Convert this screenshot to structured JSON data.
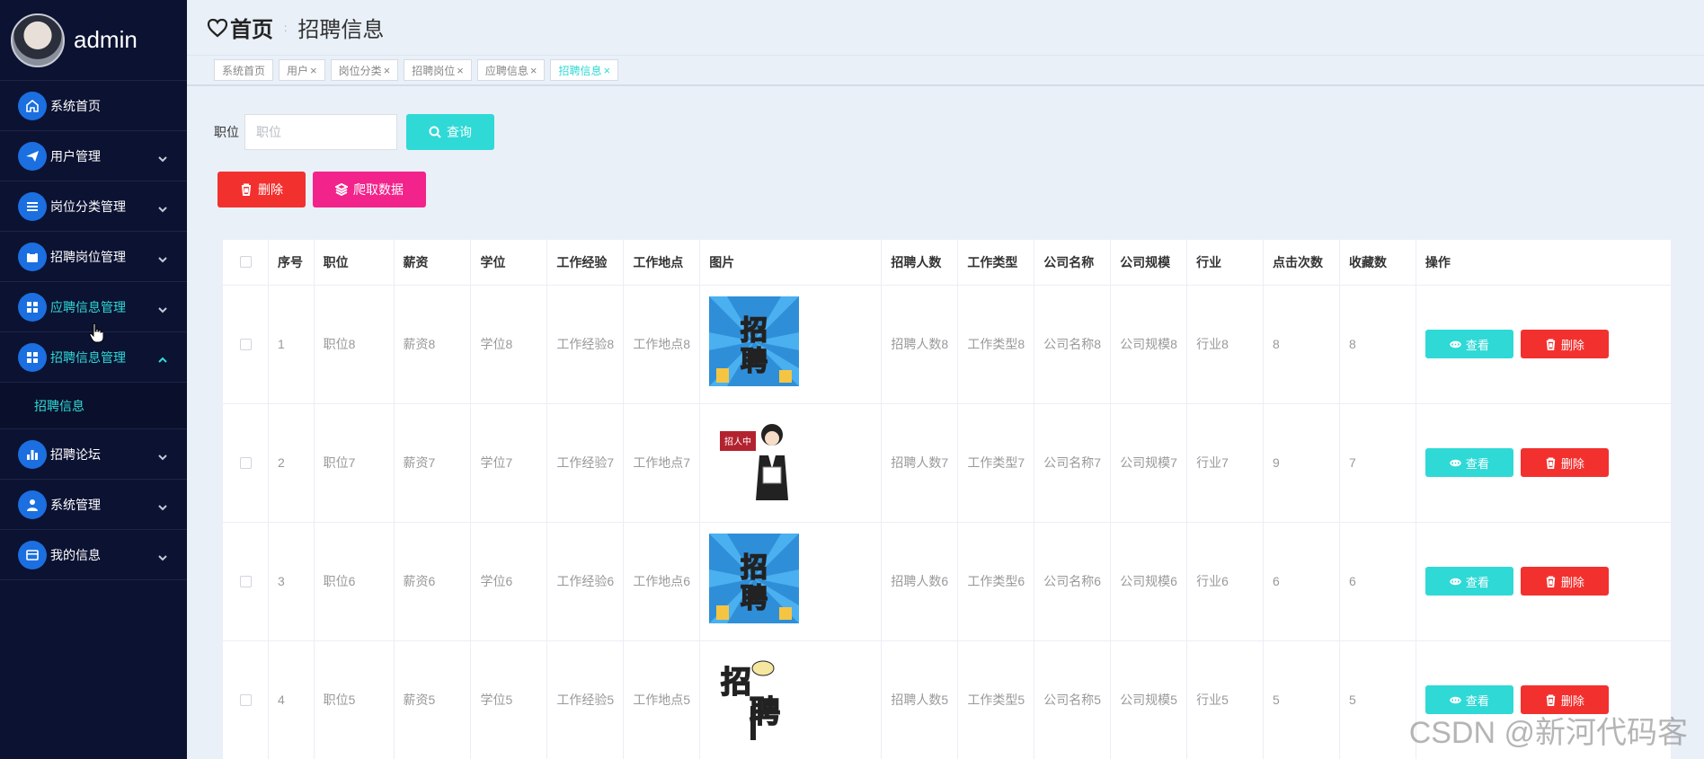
{
  "sidebar": {
    "username": "admin",
    "items": [
      {
        "label": "系统首页"
      },
      {
        "label": "用户管理"
      },
      {
        "label": "岗位分类管理"
      },
      {
        "label": "招聘岗位管理"
      },
      {
        "label": "应聘信息管理"
      },
      {
        "label": "招聘信息管理"
      },
      {
        "label": "招聘论坛"
      },
      {
        "label": "系统管理"
      },
      {
        "label": "我的信息"
      }
    ],
    "submenu": {
      "label": "招聘信息"
    }
  },
  "header": {
    "home": "首页",
    "separator": ":",
    "current": "招聘信息"
  },
  "tags": [
    {
      "label": "系统首页"
    },
    {
      "label": "用户"
    },
    {
      "label": "岗位分类"
    },
    {
      "label": "招聘岗位"
    },
    {
      "label": "应聘信息"
    },
    {
      "label": "招聘信息"
    }
  ],
  "tag_close": "×",
  "search": {
    "label": "职位",
    "placeholder": "职位",
    "button": "查询"
  },
  "toolbar": {
    "delete": "删除",
    "crawl": "爬取数据"
  },
  "table": {
    "headers": [
      "序号",
      "职位",
      "薪资",
      "学位",
      "工作经验",
      "工作地点",
      "图片",
      "招聘人数",
      "工作类型",
      "公司名称",
      "公司规模",
      "行业",
      "点击次数",
      "收藏数",
      "操作"
    ],
    "view_label": "查看",
    "delete_label": "删除",
    "rows": [
      {
        "idx": "1",
        "job": "职位8",
        "salary": "薪资8",
        "degree": "学位8",
        "exp": "工作经验8",
        "place": "工作地点8",
        "image": "recruit-poster",
        "count": "招聘人数8",
        "type": "工作类型8",
        "company": "公司名称8",
        "scale": "公司规模8",
        "industry": "行业8",
        "clicks": "8",
        "favs": "8"
      },
      {
        "idx": "2",
        "job": "职位7",
        "salary": "薪资7",
        "degree": "学位7",
        "exp": "工作经验7",
        "place": "工作地点7",
        "image": "recruiter-girl",
        "count": "招聘人数7",
        "type": "工作类型7",
        "company": "公司名称7",
        "scale": "公司规模7",
        "industry": "行业7",
        "clicks": "9",
        "favs": "7"
      },
      {
        "idx": "3",
        "job": "职位6",
        "salary": "薪资6",
        "degree": "学位6",
        "exp": "工作经验6",
        "place": "工作地点6",
        "image": "recruit-poster",
        "count": "招聘人数6",
        "type": "工作类型6",
        "company": "公司名称6",
        "scale": "公司规模6",
        "industry": "行业6",
        "clicks": "6",
        "favs": "6"
      },
      {
        "idx": "4",
        "job": "职位5",
        "salary": "薪资5",
        "degree": "学位5",
        "exp": "工作经验5",
        "place": "工作地点5",
        "image": "recruit-sign",
        "count": "招聘人数5",
        "type": "工作类型5",
        "company": "公司名称5",
        "scale": "公司规模5",
        "industry": "行业5",
        "clicks": "5",
        "favs": "5"
      }
    ]
  },
  "images": {
    "poster_text": "招聘",
    "girl_sign": "招人中",
    "sign_text": "招聘"
  },
  "watermark": "CSDN @新河代码客",
  "colors": {
    "sidebar_bg": "#0c1232",
    "accent_teal": "#2fd9d6",
    "danger_red": "#f2312f",
    "pink": "#f2238b",
    "icon_blue": "#1b6fe0"
  }
}
